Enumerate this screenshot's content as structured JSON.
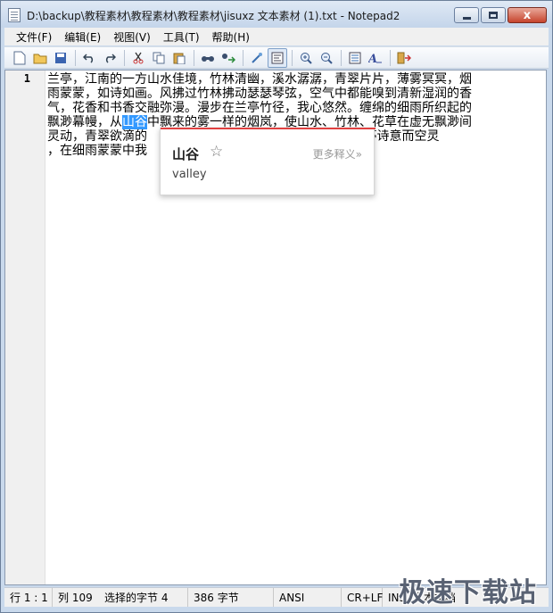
{
  "window": {
    "title": "D:\\backup\\教程素材\\教程素材\\教程素材\\jisuxz 文本素材 (1).txt - Notepad2",
    "minimize_icon": "minimize-icon",
    "maximize_icon": "maximize-icon",
    "close_label": "x"
  },
  "menu": [
    "文件(F)",
    "编辑(E)",
    "视图(V)",
    "工具(T)",
    "帮助(H)"
  ],
  "toolbar": {
    "icons": [
      "new-file-icon",
      "open-folder-icon",
      "save-icon",
      "undo-icon",
      "redo-icon",
      "cut-icon",
      "copy-icon",
      "paste-icon",
      "find-icon",
      "replace-icon",
      "wrap-icon",
      "word-wrap-toggle-icon",
      "zoom-in-icon",
      "zoom-out-icon",
      "scheme-icon",
      "font-icon",
      "exit-icon"
    ]
  },
  "editor": {
    "line_number": "1",
    "lines": [
      {
        "text": "兰亭，江南的一方山水佳境，竹林清幽，溪水潺潺，青翠片片，薄雾冥冥，烟"
      },
      {
        "text": "雨蒙蒙，如诗如画。风拂过竹林拂动瑟瑟琴弦，空气中都能嗅到清新湿润的香"
      },
      {
        "text": "气，花香和书香交融弥漫。漫步在兰亭竹径，我心悠然。缠绵的细雨所织起的"
      },
      {
        "before": "飘渺幕幔，从",
        "selected": "山谷",
        "after": "中飘来的雾一样的烟岚，使山水、竹林、花草在虚无飘渺间"
      },
      {
        "text": "灵动，青翠欲滴的                                       烟雨中的兰亭诗意而空灵"
      },
      {
        "text": "，在细雨蒙蒙中我"
      }
    ]
  },
  "popup": {
    "word": "山谷",
    "star": "☆",
    "more": "更多释义»",
    "definition": "valley"
  },
  "status": {
    "line_col": "行 1 : 1",
    "column": "列 109",
    "selected": "选择的字节 4",
    "bytes": "386 字节",
    "encoding": "ANSI",
    "eol": "CR+LF",
    "mode": "INS",
    "type": "文本文档"
  },
  "watermark": "极速下载站"
}
